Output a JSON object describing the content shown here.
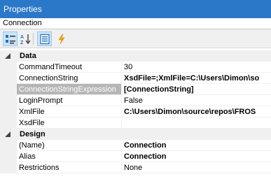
{
  "panel": {
    "title": "Properties"
  },
  "object_selector": {
    "value": "Connection"
  },
  "toolbar": {
    "buttons": [
      {
        "name": "categorized",
        "icon": "categorized-icon",
        "active": true
      },
      {
        "name": "alphabetical",
        "icon": "sort-az-icon",
        "active": false
      },
      {
        "name": "properties",
        "icon": "properties-page-icon",
        "active": true
      },
      {
        "name": "events",
        "icon": "lightning-icon",
        "active": false
      }
    ]
  },
  "categories": [
    {
      "label": "Data",
      "rows": [
        {
          "name": "CommandTimeout",
          "value": "30",
          "bold": false
        },
        {
          "name": "ConnectionString",
          "value": "XsdFile=;XmlFile=C:\\Users\\Dimon\\so",
          "bold": true
        },
        {
          "name": "ConnectionStringExpression",
          "value": "[ConnectionString]",
          "bold": true,
          "selected": true
        },
        {
          "name": "LoginPrompt",
          "value": "False",
          "bold": false
        },
        {
          "name": "XmlFile",
          "value": "C:\\Users\\Dimon\\source\\repos\\FROS",
          "bold": true
        },
        {
          "name": "XsdFile",
          "value": "",
          "bold": false
        }
      ]
    },
    {
      "label": "Design",
      "rows": [
        {
          "name": "(Name)",
          "value": "Connection",
          "bold": true
        },
        {
          "name": "Alias",
          "value": "Connection",
          "bold": true
        },
        {
          "name": "Restrictions",
          "value": "None",
          "bold": false
        }
      ]
    }
  ]
}
